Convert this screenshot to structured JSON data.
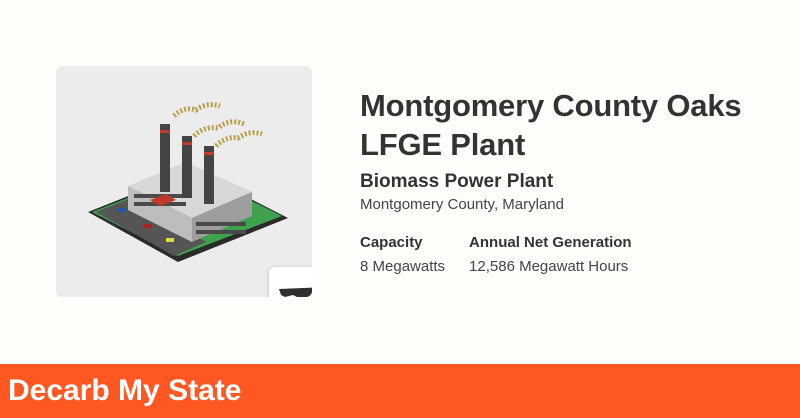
{
  "plant": {
    "name": "Montgomery County Oaks LFGE Plant",
    "type": "Biomass Power Plant",
    "location": "Montgomery County, Maryland",
    "capacity_label": "Capacity",
    "capacity_value": "8 Megawatts",
    "generation_label": "Annual Net Generation",
    "generation_value": "12,586 Megawatt Hours",
    "image_icon": "power-plant-icon",
    "state_icon": "maryland-map-icon"
  },
  "footer": {
    "brand": "Decarb My State"
  },
  "colors": {
    "accent": "#ff5722",
    "background": "#fdfdf9",
    "image_panel": "#ececec",
    "text": "#333333"
  }
}
